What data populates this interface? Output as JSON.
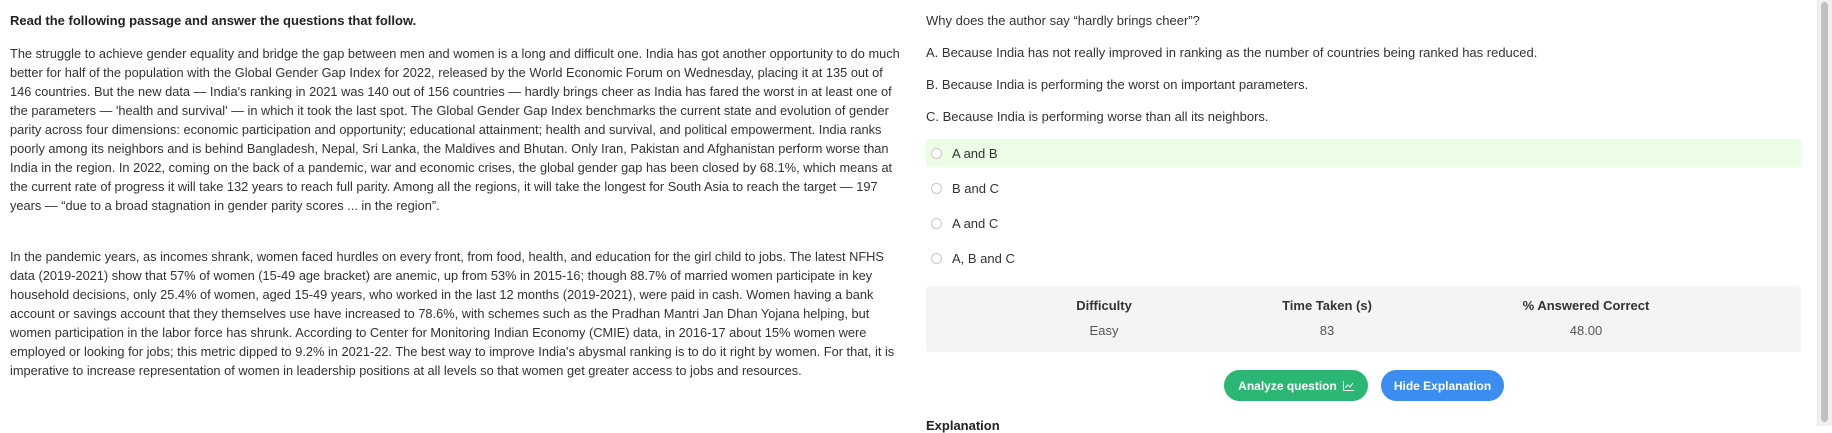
{
  "passage": {
    "instruction": "Read the following passage and answer the questions that follow.",
    "paragraph_1": "The struggle to achieve gender equality and bridge the gap between men and women is a long and difficult one. India has got another opportunity to do much better for half of the population with the Global Gender Gap Index for 2022, released by the World Economic Forum on Wednesday, placing it at 135 out of 146 countries. But the new data — India's ranking in 2021 was 140 out of 156 countries — hardly brings cheer as India has fared the worst in at least one of the parameters — 'health and survival' — in which it took the last spot. The Global Gender Gap Index benchmarks the current state and evolution of gender parity across four dimensions: economic participation and opportunity; educational attainment; health and survival, and political empowerment. India ranks poorly among its neighbors and is behind Bangladesh, Nepal, Sri Lanka, the Maldives and Bhutan. Only Iran, Pakistan and Afghanistan perform worse than India in the region. In 2022, coming on the back of a pandemic, war and economic crises, the global gender gap has been closed by 68.1%, which means at the current rate of progress it will take 132 years to reach full parity. Among all the regions, it will take the longest for South Asia to reach the target — 197 years — “due to a broad stagnation in gender parity scores ... in the region”.",
    "paragraph_2": "In the pandemic years, as incomes shrank, women faced hurdles on every front, from food, health, and education for the girl child to jobs. The latest NFHS data (2019-2021) show that 57% of women (15-49 age bracket) are anemic, up from 53% in 2015-16; though 88.7% of married women participate in key household decisions, only 25.4% of women, aged 15-49 years, who worked in the last 12 months (2019-2021), were paid in cash. Women having a bank account or savings account that they themselves use have increased to 78.6%, with schemes such as the Pradhan Mantri Jan Dhan Yojana helping, but women participation in the labor force has shrunk. According to Center for Monitoring Indian Economy (CMIE) data, in 2016-17 about 15% women were employed or looking for jobs; this metric dipped to 9.2% in 2021-22. The best way to improve India's abysmal ranking is to do it right by women. For that, it is imperative to increase representation of women in leadership positions at all levels so that women get greater access to jobs and resources."
  },
  "question": {
    "stem": "Why does the author say “hardly brings cheer”?",
    "statements": [
      "A. Because India has not really improved in ranking as the number of countries being ranked has reduced.",
      "B. Because India is performing the worst on important parameters.",
      "C. Because India is performing worse than all its neighbors."
    ],
    "options": [
      "A and B",
      "B and C",
      "A and C",
      "A, B and C"
    ]
  },
  "stats": {
    "headers": [
      "Difficulty",
      "Time Taken (s)",
      "% Answered Correct"
    ],
    "values": [
      "Easy",
      "83",
      "48.00"
    ]
  },
  "actions": {
    "analyze_label": "Analyze question",
    "hide_label": "Hide Explanation"
  },
  "explanation_heading": "Explanation",
  "colors": {
    "correct_bg": "#ebfde4",
    "analyze_btn": "#2bb673",
    "hide_btn": "#3c8df0",
    "stats_bg": "#f4f4f4"
  },
  "icons": {
    "analyze": "chart-line-icon"
  }
}
